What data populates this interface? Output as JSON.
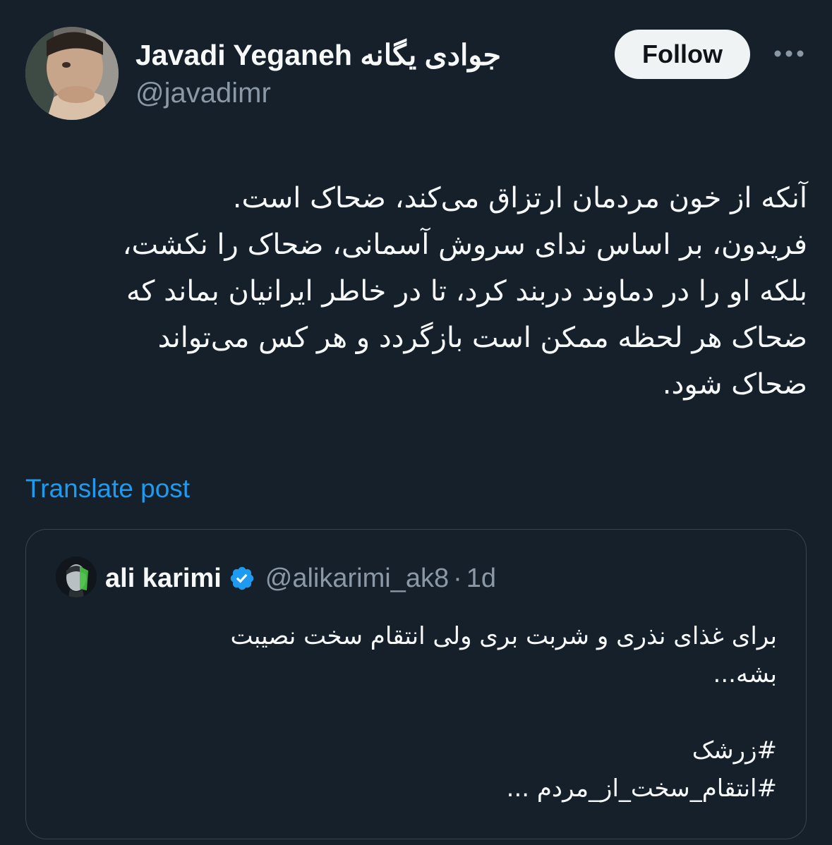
{
  "author": {
    "display_name": "Javadi Yeganeh جوادی یگانه",
    "handle": "@javadimr",
    "avatar_icon": "profile-photo"
  },
  "actions": {
    "follow_label": "Follow",
    "more_icon": "more-horizontal-icon"
  },
  "post": {
    "lines": [
      "آنکه از خون مردمان ارتزاق می‌کند، ضحاک است.",
      "فریدون، بر اساس ندای سروش آسمانی، ضحاک را نکشت،",
      "بلکه او را در دماوند دربند کرد، تا در خاطر ایرانیان بماند که",
      "ضحاک هر لحظه ممکن است بازگردد و هر کس می‌تواند",
      "ضحاک شود."
    ],
    "translate_label": "Translate post"
  },
  "quote": {
    "display_name": "ali karimi",
    "handle": "@alikarimi_ak8",
    "separator": "·",
    "time": "1d",
    "lines": [
      "برای غذای نذری و شربت بری ولی انتقام سخت نصیبت",
      "بشه...",
      "",
      "#زرشک",
      "#انتقام_سخت_از_مردم ..."
    ]
  },
  "colors": {
    "background": "#15202b",
    "text_primary": "#f7f9f9",
    "text_secondary": "#8b98a5",
    "link": "#1d9bf0",
    "follow_button_bg": "#eff3f4",
    "border": "#38444d",
    "verified": "#1d9bf0"
  }
}
